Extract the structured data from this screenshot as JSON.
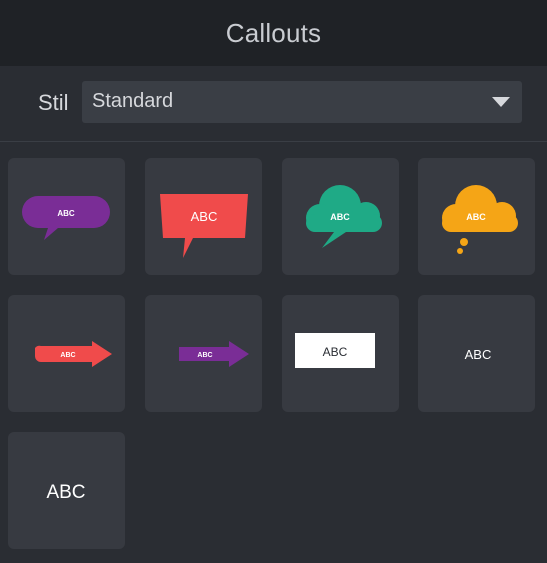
{
  "header": {
    "title": "Callouts"
  },
  "style_selector": {
    "label": "Stil",
    "selected": "Standard"
  },
  "tiles": [
    {
      "text": "ABC",
      "color": "#7a2d96"
    },
    {
      "text": "ABC",
      "color": "#f04b4b"
    },
    {
      "text": "ABC",
      "color": "#1faa86"
    },
    {
      "text": "ABC",
      "color": "#f5a516"
    },
    {
      "text": "ABC",
      "color": "#f04b4b"
    },
    {
      "text": "ABC",
      "color": "#7a2d96"
    },
    {
      "text": "ABC",
      "color": "#ffffff"
    },
    {
      "text": "ABC",
      "color": "#ffffff"
    },
    {
      "text": "ABC",
      "color": "#ffffff"
    }
  ]
}
